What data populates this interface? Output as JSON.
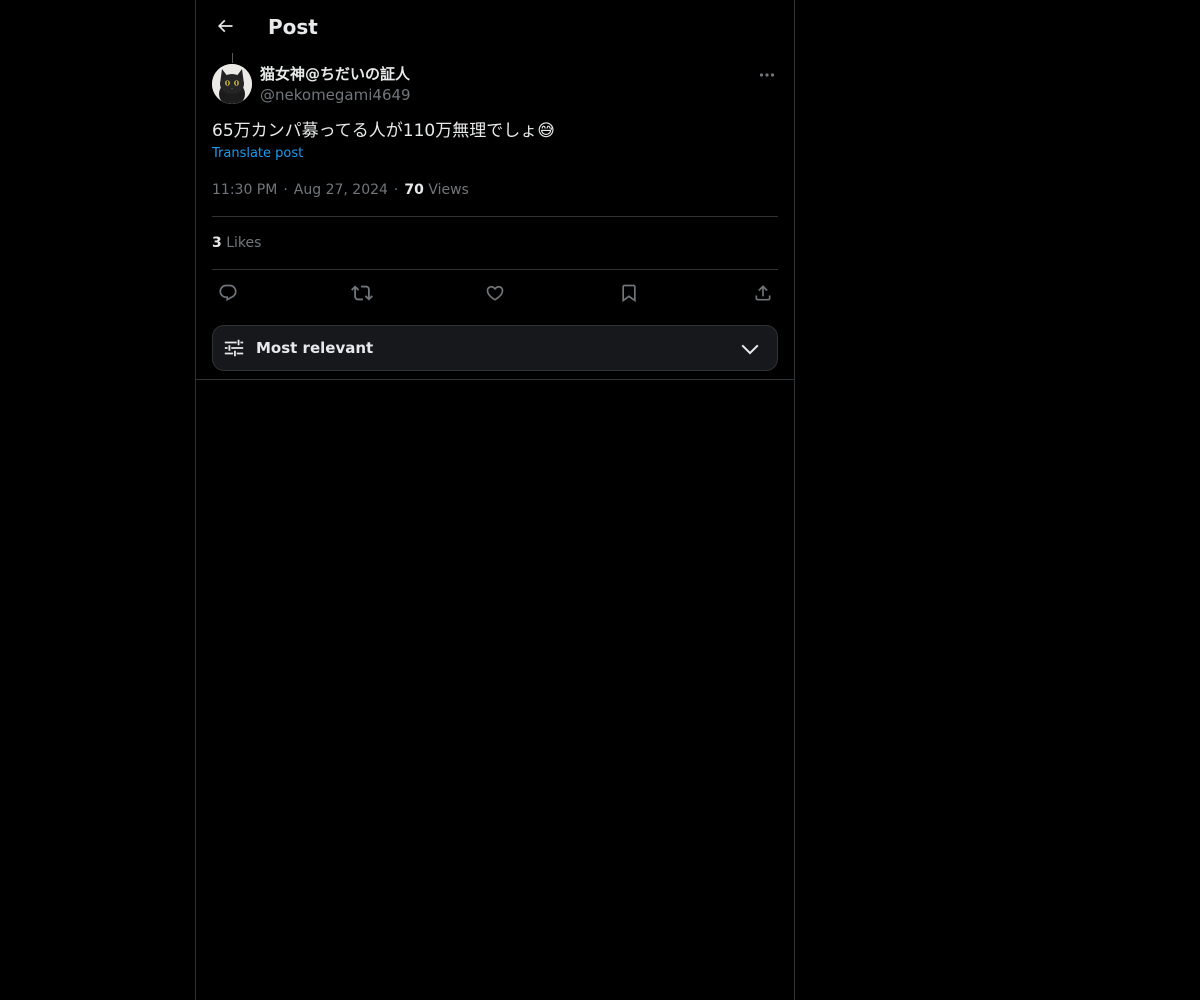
{
  "header": {
    "title": "Post"
  },
  "post": {
    "author": {
      "display_name": "猫女神@ちだいの証人",
      "handle": "@nekomegami4649"
    },
    "text": "65万カンパ募ってる人が110万無理でしょ",
    "emoji": "😅",
    "translate_label": "Translate post",
    "time": "11:30 PM",
    "date": "Aug 27, 2024",
    "views_count": "70",
    "views_label": "Views",
    "likes_count": "3",
    "likes_label": "Likes"
  },
  "replies_sort": {
    "label": "Most relevant"
  },
  "colors": {
    "background": "#000000",
    "text": "#e7e9ea",
    "muted": "#71767b",
    "link": "#1d9bf0",
    "border": "#2f3336"
  },
  "icons": [
    "back-arrow-icon",
    "more-icon",
    "reply-icon",
    "repost-icon",
    "like-icon",
    "bookmark-icon",
    "share-icon",
    "sliders-icon",
    "chevron-down-icon"
  ]
}
